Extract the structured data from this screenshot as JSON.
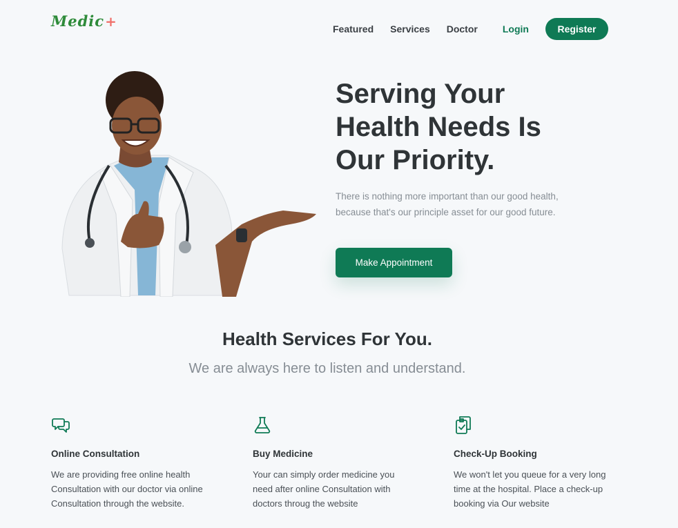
{
  "header": {
    "logo_text": "Medic",
    "logo_mark": "+",
    "nav": [
      "Featured",
      "Services",
      "Doctor"
    ],
    "login_label": "Login",
    "register_label": "Register"
  },
  "hero": {
    "title_lines": [
      "Serving Your",
      "Health Needs Is",
      "Our Priority."
    ],
    "subtitle_lines": [
      "There is nothing more important than our good health,",
      "because that's our principle asset for our good future."
    ],
    "cta_label": "Make Appointment"
  },
  "services": {
    "title": "Health Services For You.",
    "subtitle": "We are always here to listen and understand.",
    "cards": [
      {
        "icon": "chat-bubbles-icon",
        "title": "Online Consultation",
        "text": "We are providing free online health Consultation with our doctor via online Consultation through the website."
      },
      {
        "icon": "flask-icon",
        "title": "Buy Medicine",
        "text": "Your can simply order medicine you need after online Consultation with doctors throug the website"
      },
      {
        "icon": "clipboard-check-icon",
        "title": "Check-Up Booking",
        "text": "We won't let you queue for a very long time at the hospital. Place a check-up booking via Our website"
      }
    ]
  },
  "colors": {
    "brand": "#0f7a55",
    "logo": "#2e8b3a",
    "logo_mark": "#f0706a",
    "background": "#f6f8fa"
  }
}
